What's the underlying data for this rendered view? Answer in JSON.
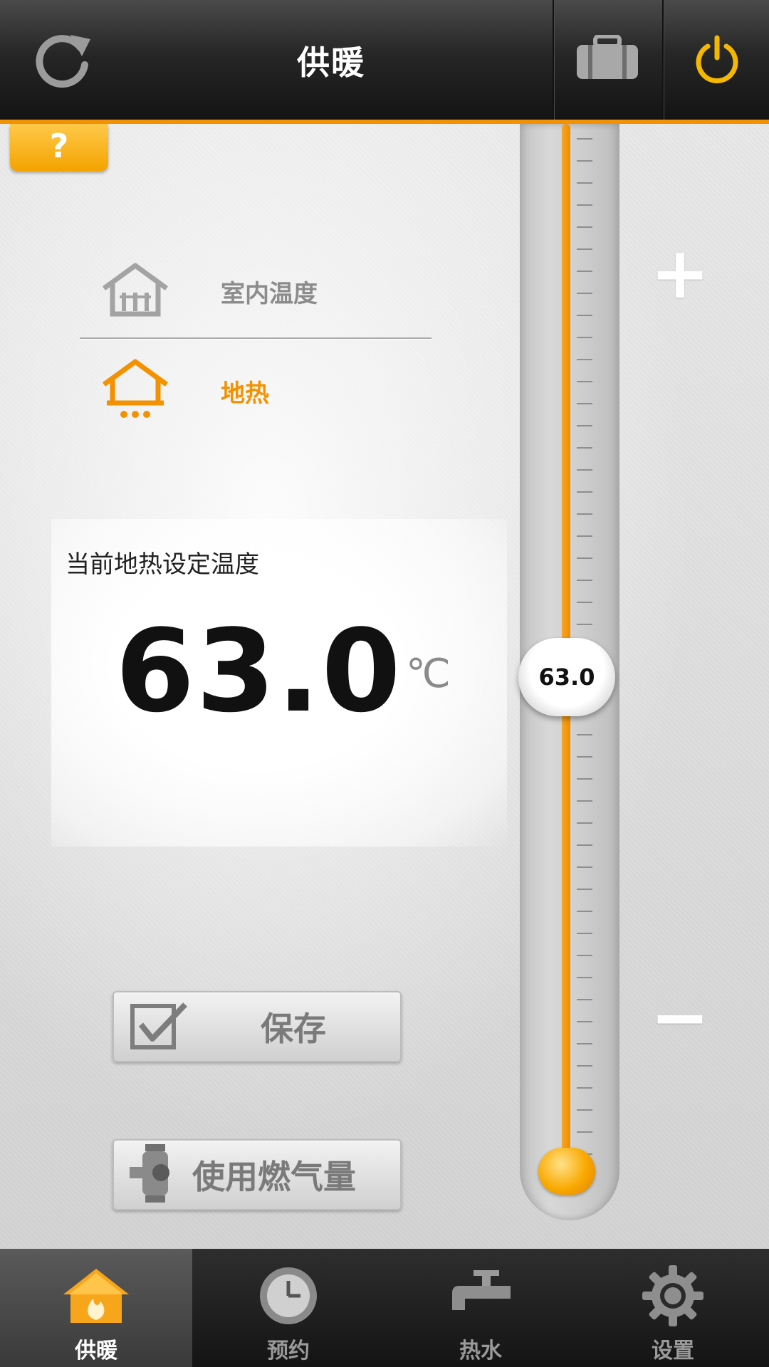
{
  "header": {
    "title": "供暖",
    "refresh_icon": "refresh-icon",
    "bag_icon": "briefcase-icon",
    "power_icon": "power-icon"
  },
  "help": {
    "label": "?"
  },
  "modes": {
    "indoor": {
      "label": "室内温度",
      "icon": "house-radiator-icon"
    },
    "floor": {
      "label": "地热",
      "icon": "house-floor-heating-icon",
      "selected": true
    }
  },
  "temperature": {
    "caption": "当前地热设定温度",
    "value": "63.0",
    "unit": "℃"
  },
  "slider": {
    "value_label": "63.0",
    "plus": "+",
    "minus": "−",
    "level": 0.53
  },
  "actions": {
    "save_label": "保存",
    "gas_label": "使用燃气量"
  },
  "tabs": [
    {
      "label": "供暖",
      "icon": "home-flame-icon",
      "active": true
    },
    {
      "label": "预约",
      "icon": "clock-icon",
      "active": false
    },
    {
      "label": "热水",
      "icon": "faucet-icon",
      "active": false
    },
    {
      "label": "设置",
      "icon": "gear-icon",
      "active": false
    }
  ],
  "colors": {
    "accent": "#f39200",
    "help_yellow": "#f4a300"
  }
}
